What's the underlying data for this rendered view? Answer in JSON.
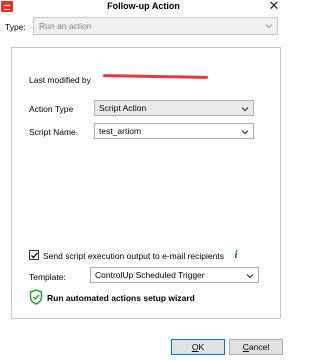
{
  "window": {
    "title": "Follow-up Action",
    "close_symbol": "✕",
    "app_icon": "controlup-logo-icon"
  },
  "type_field": {
    "label": "Type:",
    "value": "Run an action"
  },
  "details": {
    "last_modified_label": "Last modified by",
    "action_type_label": "Action Type",
    "action_type_value": "Script Action",
    "script_name_label": "Script Name",
    "script_name_value": "test_artiom"
  },
  "email_option": {
    "checked": true,
    "label": "Send script execution output to e-mail recipients",
    "info_symbol": "i"
  },
  "template": {
    "label": "Template:",
    "value": "ControlUp Scheduled Trigger"
  },
  "wizard": {
    "icon": "shield-check-icon",
    "label": "Run automated actions setup wizard"
  },
  "buttons": {
    "ok_accel": "O",
    "ok_rest": "K",
    "cancel_accel": "C",
    "cancel_rest": "ancel"
  },
  "colors": {
    "accent": "#0078d7",
    "redaction": "#e33a3a",
    "shield": "#2e9b4a"
  }
}
